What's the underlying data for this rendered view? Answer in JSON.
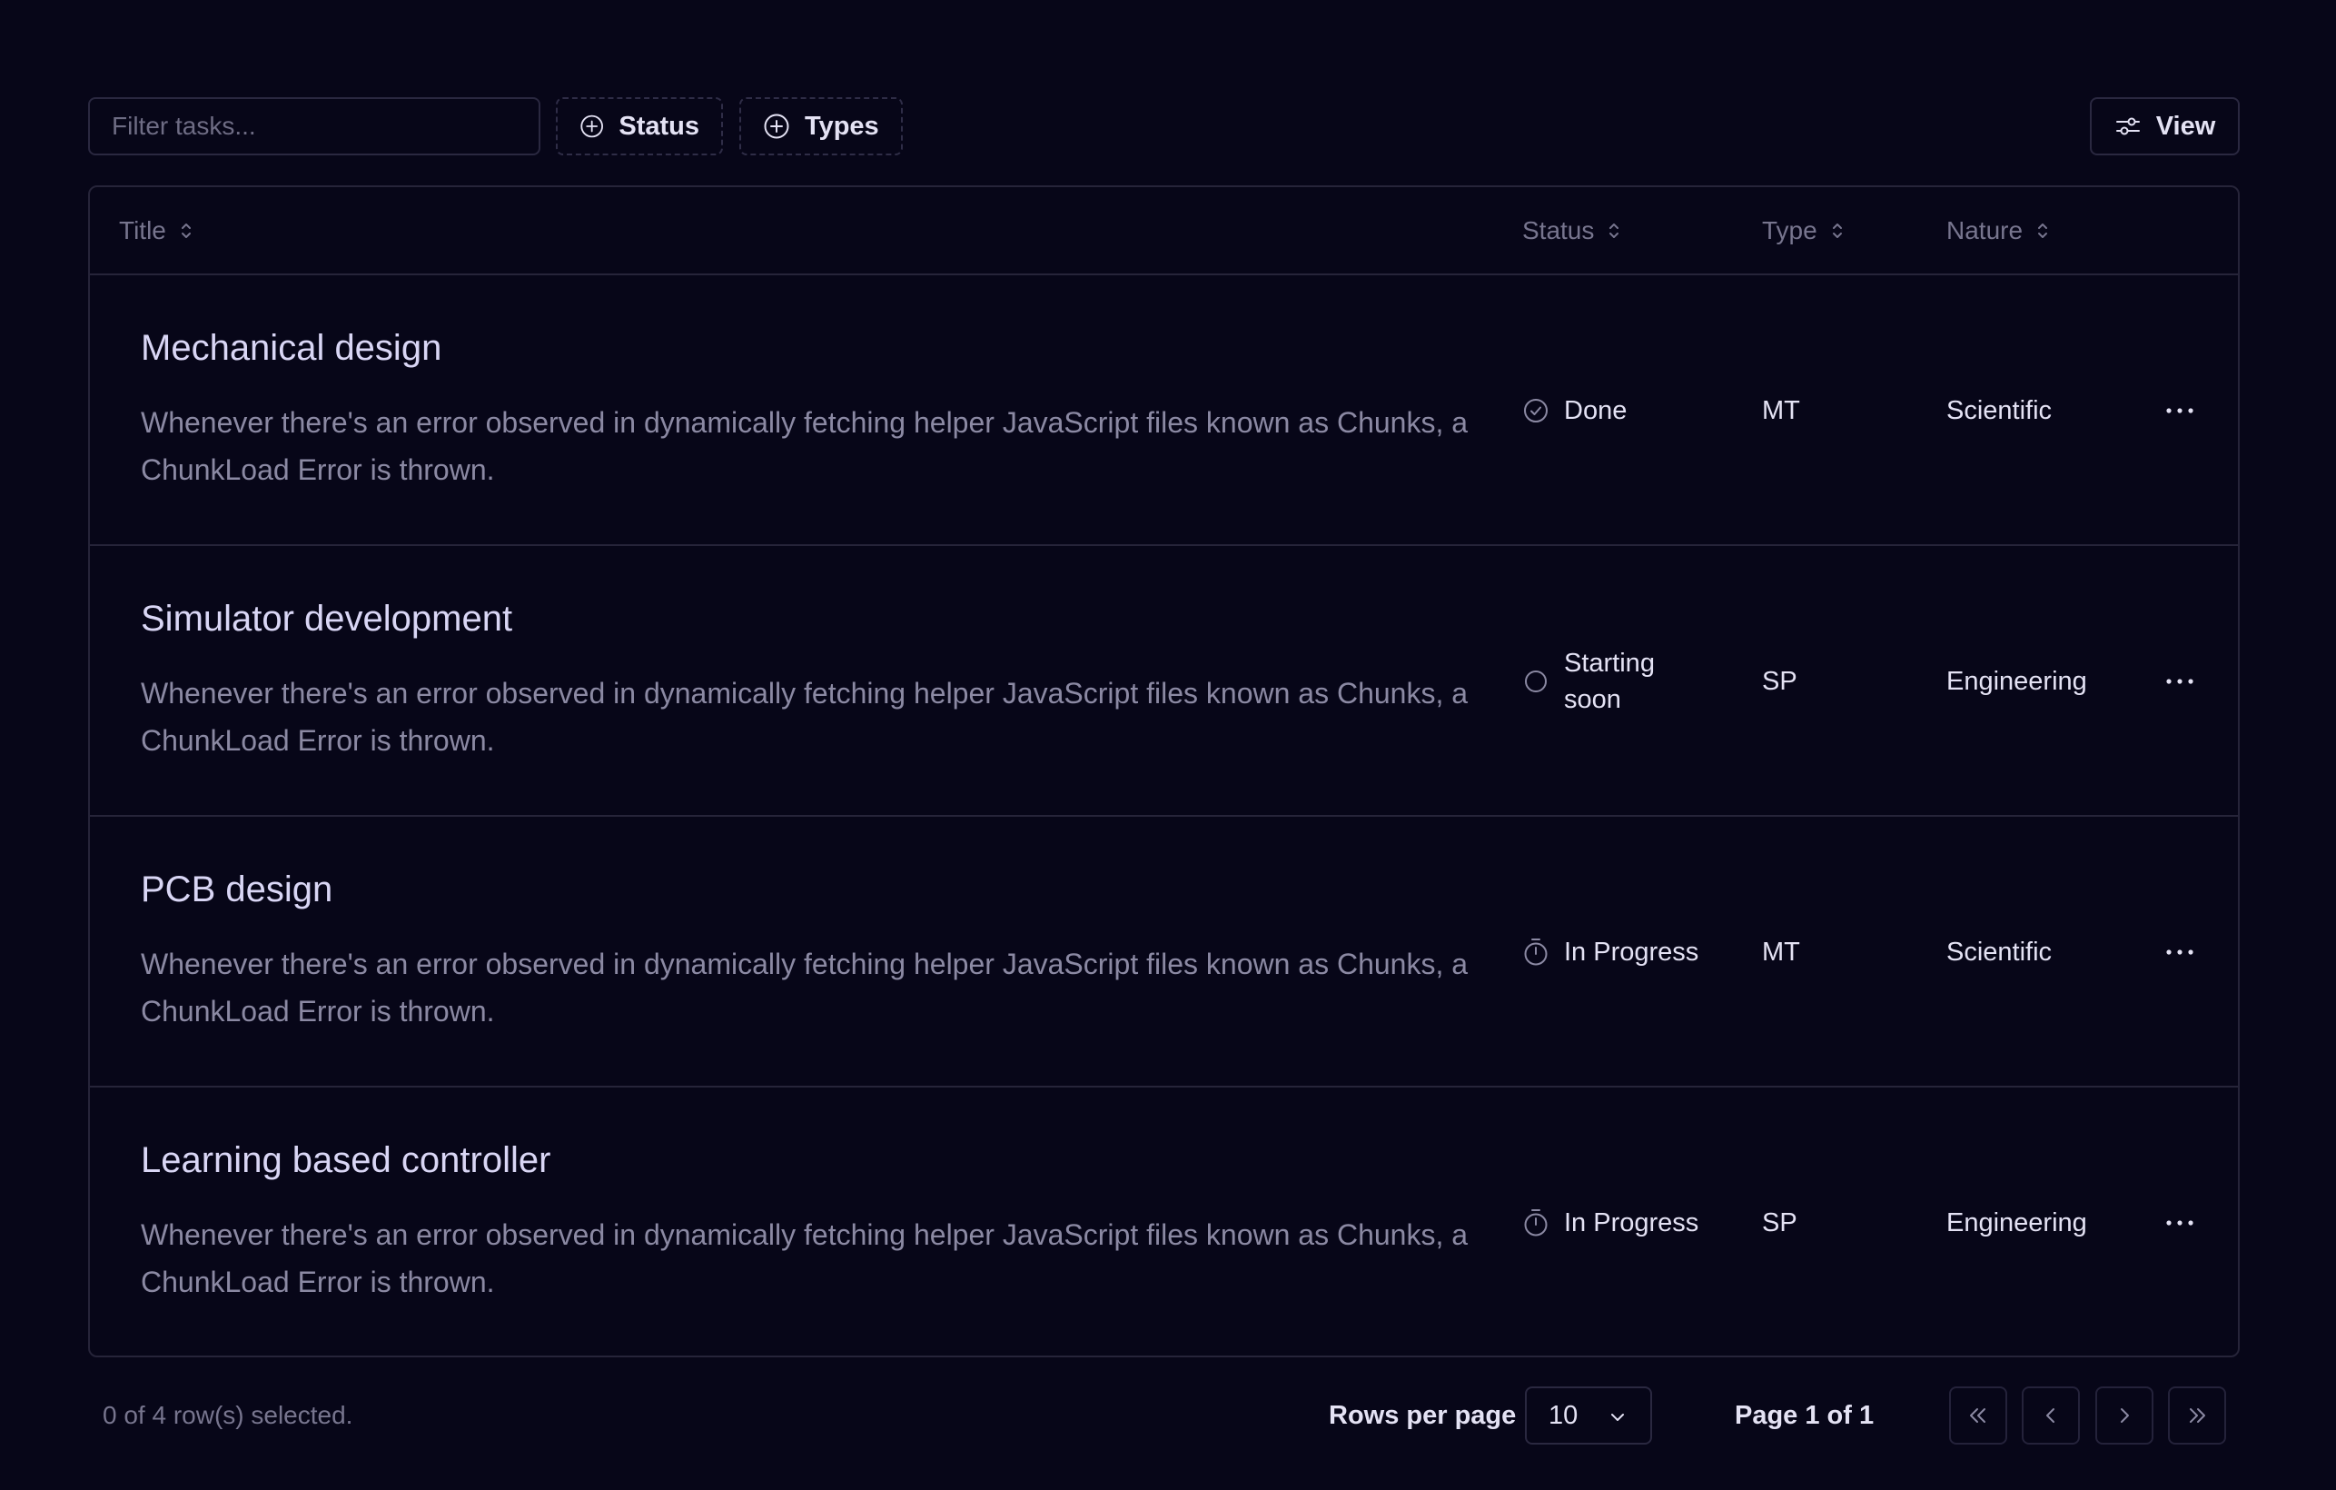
{
  "toolbar": {
    "filter_placeholder": "Filter tasks...",
    "status_chip": "Status",
    "types_chip": "Types",
    "view_button": "View"
  },
  "table": {
    "headers": {
      "title": "Title",
      "status": "Status",
      "type": "Type",
      "nature": "Nature"
    },
    "rows": [
      {
        "title": "Mechanical design",
        "description": "Whenever there's an error observed in dynamically fetching helper JavaScript files known as Chunks, a ChunkLoad Error is thrown.",
        "status": "Done",
        "status_icon": "check-circle-icon",
        "type": "MT",
        "nature": "Scientific"
      },
      {
        "title": "Simulator development",
        "description": "Whenever there's an error observed in dynamically fetching helper JavaScript files known as Chunks, a ChunkLoad Error is thrown.",
        "status": "Starting soon",
        "status_icon": "circle-icon",
        "type": "SP",
        "nature": "Engineering"
      },
      {
        "title": "PCB design",
        "description": "Whenever there's an error observed in dynamically fetching helper JavaScript files known as Chunks, a ChunkLoad Error is thrown.",
        "status": "In Progress",
        "status_icon": "timer-icon",
        "type": "MT",
        "nature": "Scientific"
      },
      {
        "title": "Learning based controller",
        "description": "Whenever there's an error observed in dynamically fetching helper JavaScript files known as Chunks, a ChunkLoad Error is thrown.",
        "status": "In Progress",
        "status_icon": "timer-icon",
        "type": "SP",
        "nature": "Engineering"
      }
    ]
  },
  "footer": {
    "selected_info": "0 of 4 row(s) selected.",
    "rows_per_page_label": "Rows per page",
    "rows_per_page_value": "10",
    "page_info": "Page 1 of 1"
  },
  "colors": {
    "background": "#070618",
    "border": "#262439",
    "title_text": "#d9d6f5",
    "muted_text": "#8b89a3"
  }
}
